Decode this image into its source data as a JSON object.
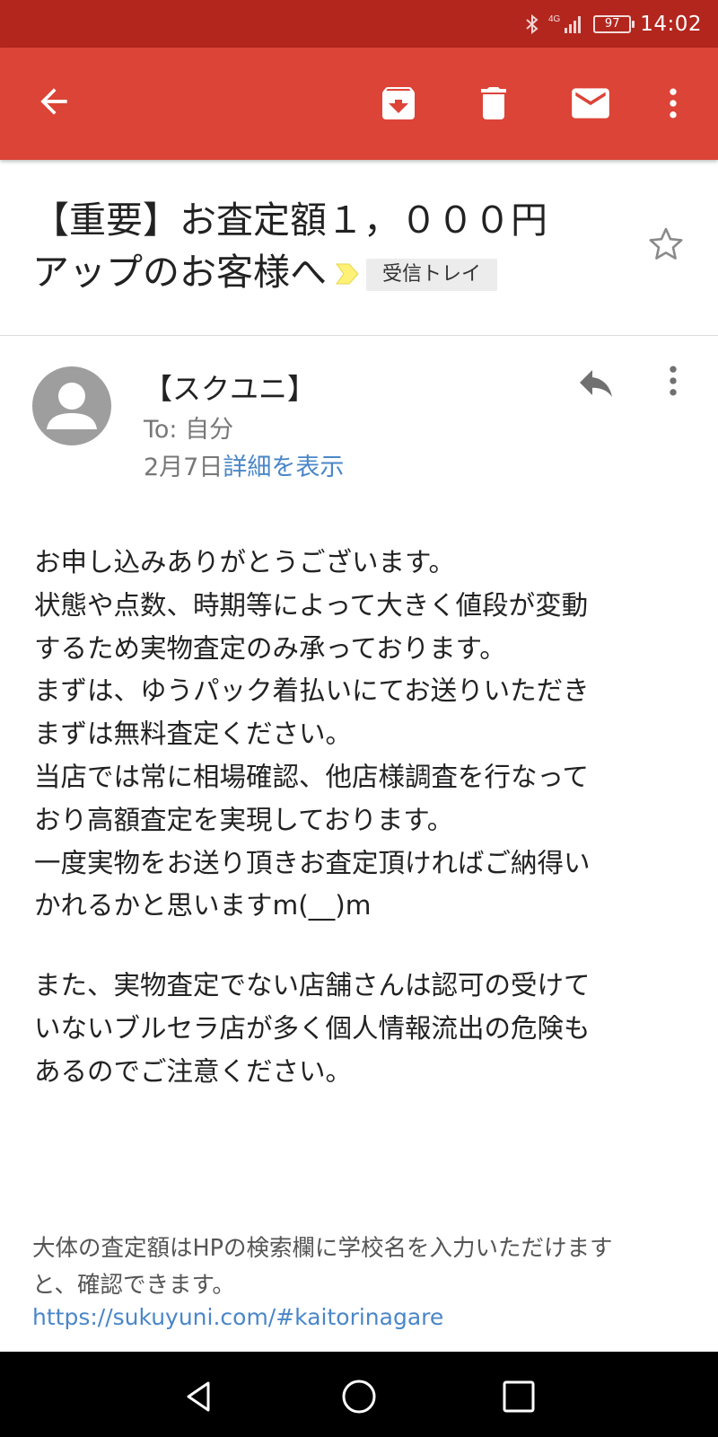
{
  "status_bar": {
    "network": "4G",
    "battery": "97",
    "time": "14:02"
  },
  "toolbar": {
    "icons": [
      "back-arrow-icon",
      "archive-icon",
      "trash-icon",
      "mail-icon",
      "more-vert-icon"
    ]
  },
  "email": {
    "subject_line1": "【重要】お査定額１，０００円",
    "subject_line2": "アップのお客様へ",
    "label": "受信トレイ",
    "sender": "【スクユニ】",
    "to": "To: 自分",
    "date": "2月7日",
    "details_link": "詳細を表示",
    "body_para1": [
      "お申し込みありがとうございます。",
      "状態や点数、時期等によって大きく値段が変動",
      "するため実物査定のみ承っております。",
      "まずは、ゆうパック着払いにてお送りいただき",
      "まずは無料査定ください。",
      "当店では常に相場確認、他店様調査を行なって",
      "おり高額査定を実現しております。",
      "一度実物をお送り頂きお査定頂ければご納得い",
      "かれるかと思いますm(__)m"
    ],
    "body_para2": [
      "また、実物査定でない店舗さんは認可の受けて",
      "いないブルセラ店が多く個人情報流出の危険も",
      "あるのでご注意ください。"
    ],
    "footer_lines": [
      "大体の査定額はHPの検索欄に学校名を入力いただけます",
      "と、確認できます。"
    ],
    "footer_link": "https://sukuyuni.com/#kaitorinagare"
  },
  "colors": {
    "status_bar": "#b3261e",
    "app_bar": "#db4437",
    "link": "#4a86c8",
    "important_marker": "#fff176"
  }
}
